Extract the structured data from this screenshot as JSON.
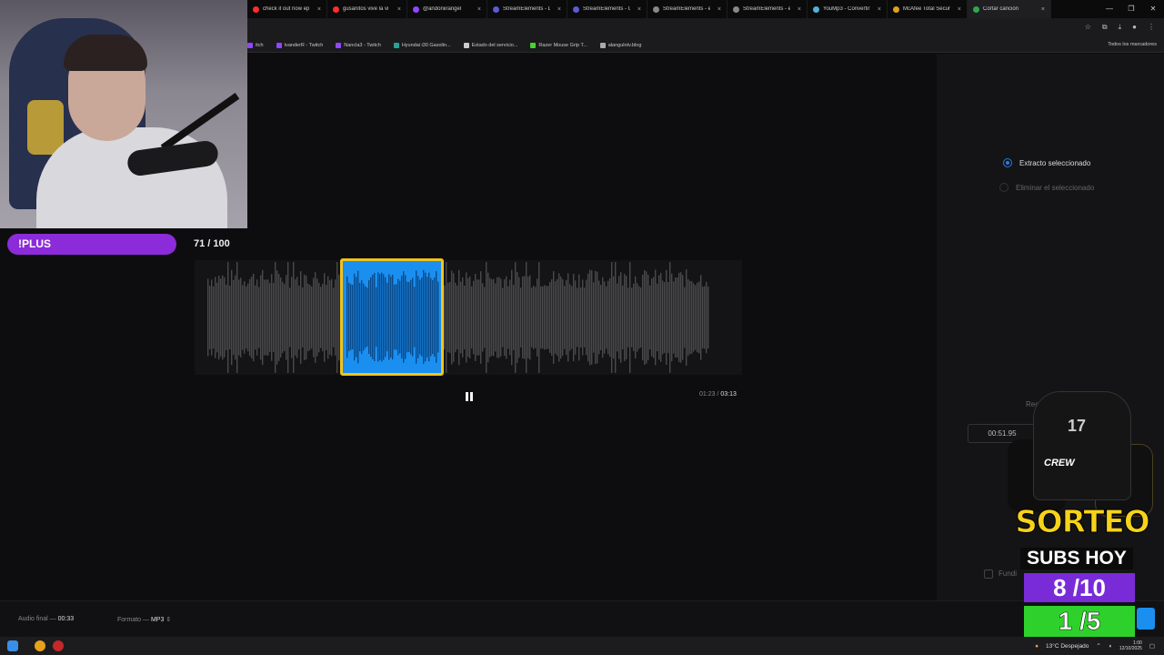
{
  "browser": {
    "tabs": [
      {
        "label": "check it out now ep",
        "color": "#ff2d2d",
        "active": false
      },
      {
        "label": "gusanitos vive la vi",
        "color": "#ff2d2d",
        "active": false
      },
      {
        "label": "@andoniirangel",
        "color": "#9146ff",
        "active": false
      },
      {
        "label": "StreamElements - D",
        "color": "#5b5bd6",
        "active": false
      },
      {
        "label": "StreamElements - C",
        "color": "#5b5bd6",
        "active": false
      },
      {
        "label": "StreamElements - e",
        "color": "#888888",
        "active": false
      },
      {
        "label": "StreamElements - e",
        "color": "#888888",
        "active": false
      },
      {
        "label": "YouMp3 - Convertir",
        "color": "#4fb3d9",
        "active": false
      },
      {
        "label": "McAfee Total Secur",
        "color": "#e0a020",
        "active": false
      },
      {
        "label": "Cortar cancion",
        "color": "#2fa84f",
        "active": true
      }
    ],
    "bookmarks": [
      {
        "label": "itch",
        "color": "#9146ff"
      },
      {
        "label": "tvanderR - Twitch",
        "color": "#9146ff"
      },
      {
        "label": "Nancla3 - Twitch",
        "color": "#9146ff"
      },
      {
        "label": "Hyundai i30 Gasolin...",
        "color": "#2aa198"
      },
      {
        "label": "Estado del servicio...",
        "color": "#cccccc"
      },
      {
        "label": "Razer Mouse Grip T...",
        "color": "#44d62c"
      },
      {
        "label": "alangulotv.blog",
        "color": "#aaaaaa"
      }
    ],
    "bookmarks_right": "Todos los marcadores"
  },
  "overlay": {
    "plus_label": "!PLUS",
    "plus_count": "71 / 100"
  },
  "editor": {
    "time_current": "01:23",
    "time_separator": "/",
    "time_total": "03:13",
    "options": {
      "selected_extract": "Extracto seleccionado",
      "delete_selected": "Eliminar el seleccionado"
    },
    "rec_label": "Rec",
    "time_box": "00:51.95",
    "fund_label": "Fundi",
    "bottom": {
      "audio_final_label": "Audio final",
      "audio_final_value": "00:33",
      "format_label": "Formato",
      "format_value": "MP3",
      "dash": "—"
    }
  },
  "taskbar": {
    "weather": "13°C Despejado",
    "time": "1:00",
    "date": "12/10/2025"
  },
  "giveaway": {
    "crew": "CREW",
    "jersey_number": "17",
    "title": "SORTEO",
    "subs_label": "SUBS HOY",
    "subs_count": "8 /10",
    "winners": "1 /5"
  },
  "colors": {
    "accent_blue": "#1a8ff0",
    "selection_border": "#f2c318",
    "plus_purple": "#8b2bd9"
  }
}
